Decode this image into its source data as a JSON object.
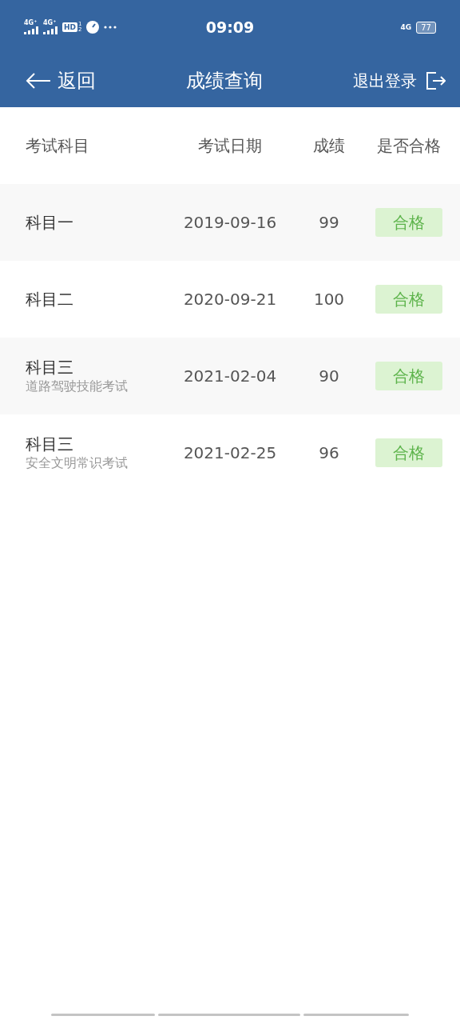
{
  "status_bar": {
    "sim_labels": [
      "4G⁺",
      "4G⁺"
    ],
    "hd": "HD",
    "hd_sub": "1",
    "hd_sub2": "2",
    "time": "09:09",
    "right_network": "4G",
    "battery": "77"
  },
  "nav": {
    "back": "返回",
    "title": "成绩查询",
    "logout": "退出登录"
  },
  "table": {
    "columns": [
      "考试科目",
      "考试日期",
      "成绩",
      "是否合格"
    ],
    "rows": [
      {
        "subject": "科目一",
        "date": "2019-09-16",
        "score": "99",
        "result": "合格",
        "passed": true
      },
      {
        "subject": "科目二",
        "date": "2020-09-21",
        "score": "100",
        "result": "合格",
        "passed": true
      },
      {
        "subject": "科目三",
        "detail": "道路驾驶技能考试",
        "date": "2021-02-04",
        "score": "90",
        "result": "合格",
        "passed": true
      },
      {
        "subject": "科目三",
        "detail": "安全文明常识考试",
        "date": "2021-02-25",
        "score": "96",
        "result": "合格",
        "passed": true
      }
    ]
  }
}
